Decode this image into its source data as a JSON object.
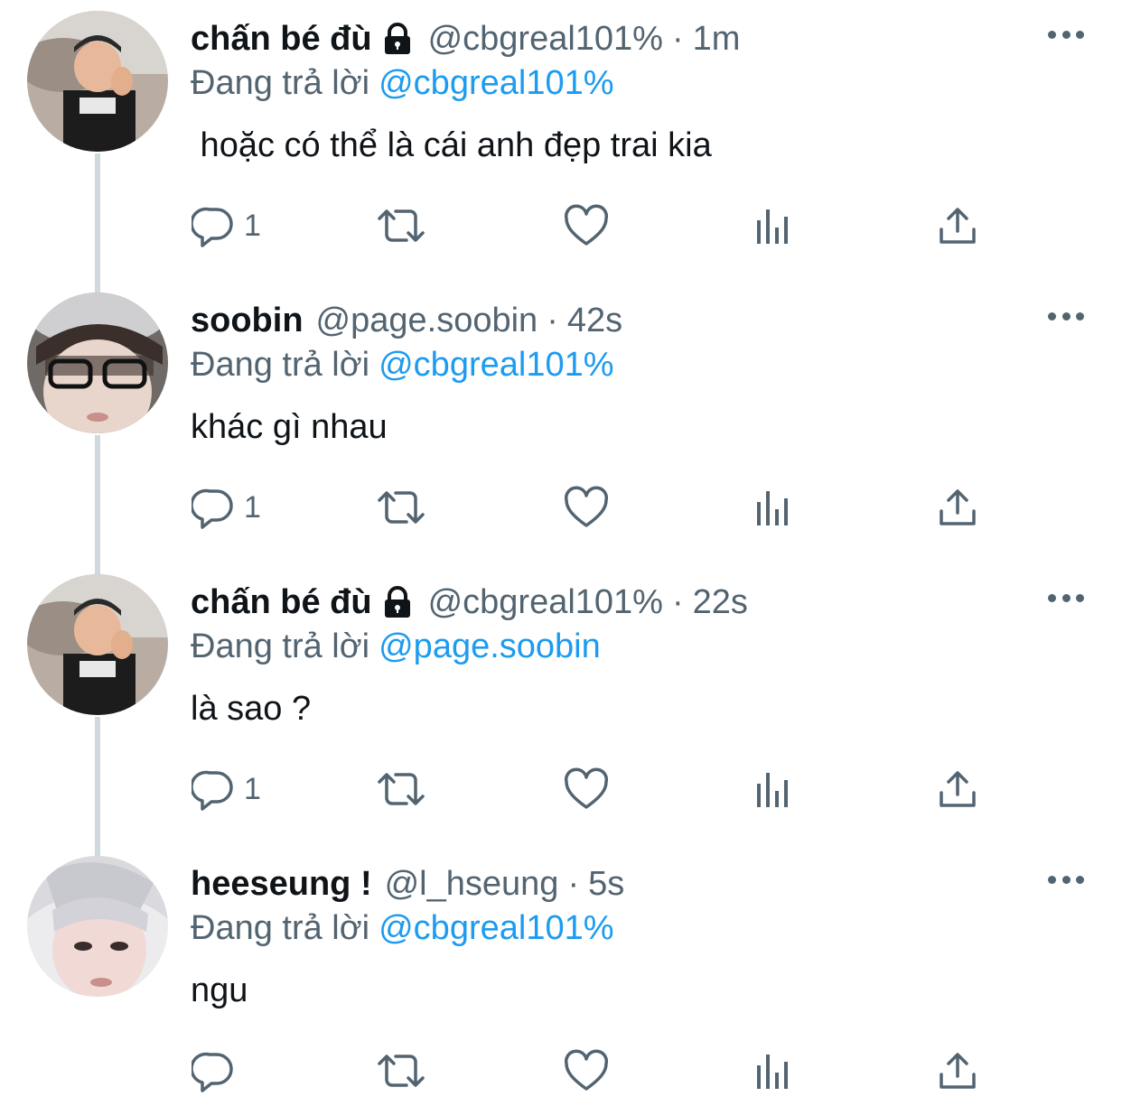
{
  "tweets": [
    {
      "name": "chấn bé đù",
      "protected": true,
      "handle": "@cbgreal101%",
      "dot": "·",
      "time": "1m",
      "reply_prefix": "Đang trả lời",
      "reply_mention": "@cbgreal101%",
      "text": " hoặc có thể là cái anh đẹp trai kia",
      "reply_count": "1"
    },
    {
      "name": "soobin",
      "protected": false,
      "handle": "@page.soobin",
      "dot": "·",
      "time": "42s",
      "reply_prefix": "Đang trả lời",
      "reply_mention": "@cbgreal101%",
      "text": "khác gì nhau",
      "reply_count": "1"
    },
    {
      "name": "chấn bé đù",
      "protected": true,
      "handle": "@cbgreal101%",
      "dot": "·",
      "time": "22s",
      "reply_prefix": "Đang trả lời",
      "reply_mention": "@page.soobin",
      "text": "là sao ?",
      "reply_count": "1"
    },
    {
      "name": "heeseung !",
      "protected": false,
      "handle": "@l_hseung",
      "dot": "·",
      "time": "5s",
      "reply_prefix": "Đang trả lời",
      "reply_mention": "@cbgreal101%",
      "text": "ngu",
      "reply_count": ""
    }
  ],
  "icons": {
    "reply": "reply-icon",
    "retweet": "retweet-icon",
    "like": "heart-icon",
    "views": "views-icon",
    "share": "share-icon",
    "more": "more-icon",
    "lock": "lock-icon"
  },
  "colors": {
    "text": "#0f1419",
    "secondary": "#536471",
    "mention": "#1d9bf0",
    "thread_line": "#cfd9de"
  }
}
